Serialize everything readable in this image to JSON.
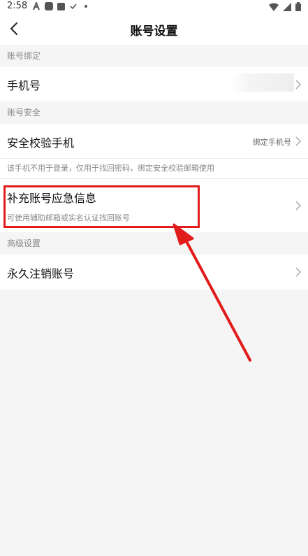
{
  "status_bar": {
    "time": "2:58"
  },
  "nav": {
    "title": "账号设置"
  },
  "sections": {
    "binding": {
      "header": "账号绑定"
    },
    "security": {
      "header": "账号安全"
    },
    "advanced": {
      "header": "高级设置"
    }
  },
  "rows": {
    "phone": {
      "label": "手机号",
      "value": ""
    },
    "verify_phone": {
      "label": "安全校验手机",
      "value": "绑定手机号"
    },
    "verify_phone_note": "该手机不用于登录，仅用于找回密码，绑定安全校验邮箱使用",
    "emergency": {
      "label": "补充账号应急信息",
      "sub": "可使用辅助邮箱或实名认证找回账号"
    },
    "delete_account": {
      "label": "永久注销账号"
    }
  },
  "colors": {
    "highlight": "#e21b1b",
    "background": "#f5f5f5"
  }
}
